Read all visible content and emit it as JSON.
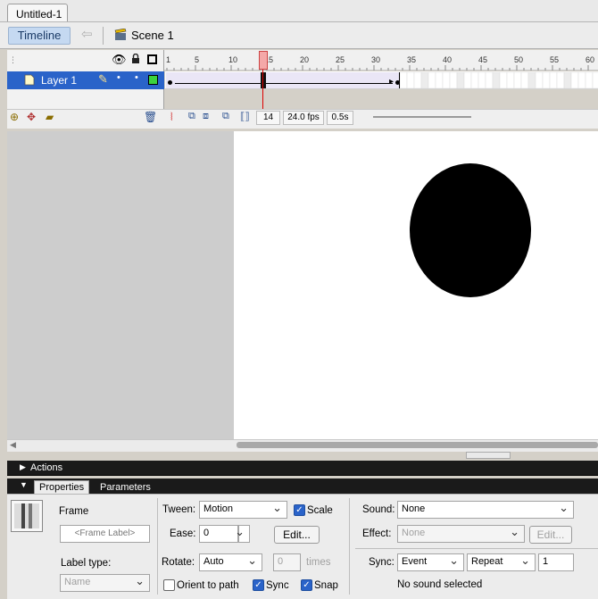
{
  "document": {
    "tab_title": "Untitled-1"
  },
  "editbar": {
    "timeline_button": "Timeline",
    "scene_label": "Scene 1"
  },
  "timeline": {
    "ruler_numbers": [
      "1",
      "5",
      "10",
      "15",
      "20",
      "25",
      "30",
      "35",
      "40",
      "45",
      "50",
      "55",
      "60"
    ],
    "layer_name": "Layer 1",
    "current_frame": "14",
    "frame_rate": "24.0 fps",
    "elapsed_time": "0.5s",
    "playhead_frame": 14
  },
  "panels": {
    "actions_title": "Actions",
    "properties_tab": "Properties",
    "parameters_tab": "Parameters"
  },
  "properties": {
    "frame_label_title": "Frame",
    "frame_label_placeholder": "<Frame Label>",
    "label_type_title": "Label type:",
    "label_type_value": "Name",
    "tween_label": "Tween:",
    "tween_value": "Motion",
    "scale_label": "Scale",
    "scale_checked": true,
    "ease_label": "Ease:",
    "ease_value": "0",
    "edit_button": "Edit...",
    "rotate_label": "Rotate:",
    "rotate_value": "Auto",
    "times_value": "0",
    "times_label": "times",
    "orient_label": "Orient to path",
    "sync_cb_label": "Sync",
    "snap_label": "Snap",
    "sound_label": "Sound:",
    "sound_value": "None",
    "effect_label": "Effect:",
    "effect_value": "None",
    "effect_edit_button": "Edit...",
    "sync_label": "Sync:",
    "sync_value": "Event",
    "repeat_value": "Repeat",
    "repeat_count": "1",
    "no_sound_text": "No sound selected"
  },
  "colors": {
    "selection": "#2a63c9",
    "stage": "#ffffff",
    "pasteboard": "#cdcdcd",
    "playhead": "#f4a8a8",
    "panel_bar": "#1a1a1a"
  }
}
